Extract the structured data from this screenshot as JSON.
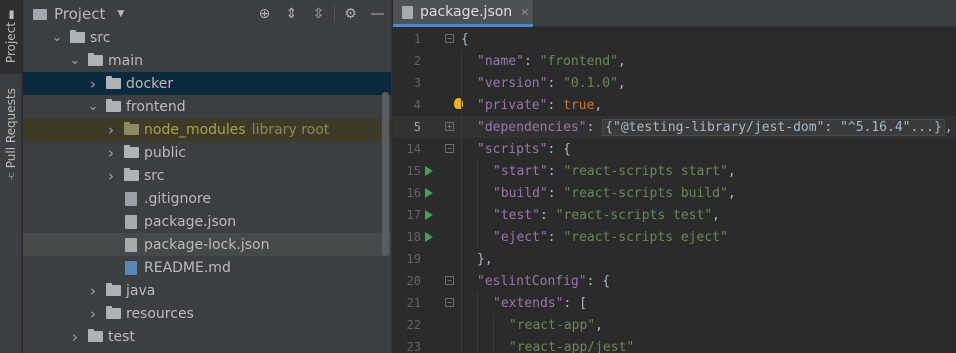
{
  "stripe": {
    "project_label": "Project",
    "pull_requests_label": "Pull Requests"
  },
  "project_panel": {
    "title": "Project",
    "tools": [
      "locate-icon",
      "expand-all-icon",
      "collapse-all-icon",
      "gear-icon",
      "minimize-icon"
    ],
    "tree": [
      {
        "name": "src",
        "type": "folder",
        "indent": 1,
        "expanded": true
      },
      {
        "name": "main",
        "type": "folder",
        "indent": 2,
        "expanded": true
      },
      {
        "name": "docker",
        "type": "folder",
        "indent": 3,
        "expanded": false,
        "selected": true
      },
      {
        "name": "frontend",
        "type": "folder",
        "indent": 3,
        "expanded": true
      },
      {
        "name": "node_modules",
        "type": "folder",
        "indent": 4,
        "expanded": false,
        "excluded": true,
        "extra": "library root"
      },
      {
        "name": "public",
        "type": "folder",
        "indent": 4,
        "expanded": false
      },
      {
        "name": "src",
        "type": "folder",
        "indent": 4,
        "expanded": false
      },
      {
        "name": ".gitignore",
        "type": "file",
        "indent": 4
      },
      {
        "name": "package.json",
        "type": "json",
        "indent": 4
      },
      {
        "name": "package-lock.json",
        "type": "json",
        "indent": 4,
        "hover": true
      },
      {
        "name": "README.md",
        "type": "md",
        "indent": 4
      },
      {
        "name": "java",
        "type": "folder",
        "indent": 3,
        "expanded": false
      },
      {
        "name": "resources",
        "type": "folder",
        "indent": 3,
        "expanded": false
      },
      {
        "name": "test",
        "type": "folder",
        "indent": 2,
        "expanded": false
      }
    ]
  },
  "editor": {
    "tab_label": "package.json",
    "current_line": "5",
    "lines": [
      {
        "n": "1",
        "level": 0,
        "fold": true,
        "parts": [
          [
            "p",
            "{"
          ]
        ]
      },
      {
        "n": "2",
        "level": 1,
        "parts": [
          [
            "k",
            "\"name\""
          ],
          [
            "p",
            ": "
          ],
          [
            "s",
            "\"frontend\""
          ],
          [
            "p",
            ","
          ]
        ]
      },
      {
        "n": "3",
        "level": 1,
        "parts": [
          [
            "k",
            "\"version\""
          ],
          [
            "p",
            ": "
          ],
          [
            "s",
            "\"0.1.0\""
          ],
          [
            "p",
            ","
          ]
        ]
      },
      {
        "n": "4",
        "level": 1,
        "bulb": true,
        "parts": [
          [
            "k",
            "\"private\""
          ],
          [
            "p",
            ": "
          ],
          [
            "kw",
            "true"
          ],
          [
            "p",
            ","
          ]
        ]
      },
      {
        "n": "5",
        "level": 1,
        "fold": true,
        "parts": [
          [
            "k",
            "\"dependencies\""
          ],
          [
            "p",
            ": "
          ],
          [
            "f",
            "{\"@testing-library/jest-dom\": \"^5.16.4\"...}"
          ],
          [
            "p",
            ","
          ]
        ]
      },
      {
        "n": "14",
        "level": 1,
        "fold": true,
        "parts": [
          [
            "k",
            "\"scripts\""
          ],
          [
            "p",
            ": {"
          ]
        ]
      },
      {
        "n": "15",
        "level": 2,
        "run": true,
        "parts": [
          [
            "k",
            "\"start\""
          ],
          [
            "p",
            ": "
          ],
          [
            "s",
            "\"react-scripts start\""
          ],
          [
            "p",
            ","
          ]
        ]
      },
      {
        "n": "16",
        "level": 2,
        "run": true,
        "parts": [
          [
            "k",
            "\"build\""
          ],
          [
            "p",
            ": "
          ],
          [
            "s",
            "\"react-scripts build\""
          ],
          [
            "p",
            ","
          ]
        ]
      },
      {
        "n": "17",
        "level": 2,
        "run": true,
        "parts": [
          [
            "k",
            "\"test\""
          ],
          [
            "p",
            ": "
          ],
          [
            "s",
            "\"react-scripts test\""
          ],
          [
            "p",
            ","
          ]
        ]
      },
      {
        "n": "18",
        "level": 2,
        "run": true,
        "parts": [
          [
            "k",
            "\"eject\""
          ],
          [
            "p",
            ": "
          ],
          [
            "s",
            "\"react-scripts eject\""
          ]
        ]
      },
      {
        "n": "19",
        "level": 1,
        "parts": [
          [
            "p",
            "},"
          ]
        ]
      },
      {
        "n": "20",
        "level": 1,
        "fold": true,
        "parts": [
          [
            "k",
            "\"eslintConfig\""
          ],
          [
            "p",
            ": {"
          ]
        ]
      },
      {
        "n": "21",
        "level": 2,
        "fold": true,
        "parts": [
          [
            "k",
            "\"extends\""
          ],
          [
            "p",
            ": ["
          ]
        ]
      },
      {
        "n": "22",
        "level": 3,
        "parts": [
          [
            "s",
            "\"react-app\""
          ],
          [
            "p",
            ","
          ]
        ]
      },
      {
        "n": "23",
        "level": 3,
        "parts": [
          [
            "s",
            "\"react-app/jest\""
          ]
        ]
      }
    ]
  },
  "colors": {
    "key": "#9876aa",
    "string": "#6a8759",
    "keyword": "#cc7832",
    "selection": "#0d293e",
    "tab_underline": "#4a88c7",
    "run_icon": "#499c54"
  }
}
